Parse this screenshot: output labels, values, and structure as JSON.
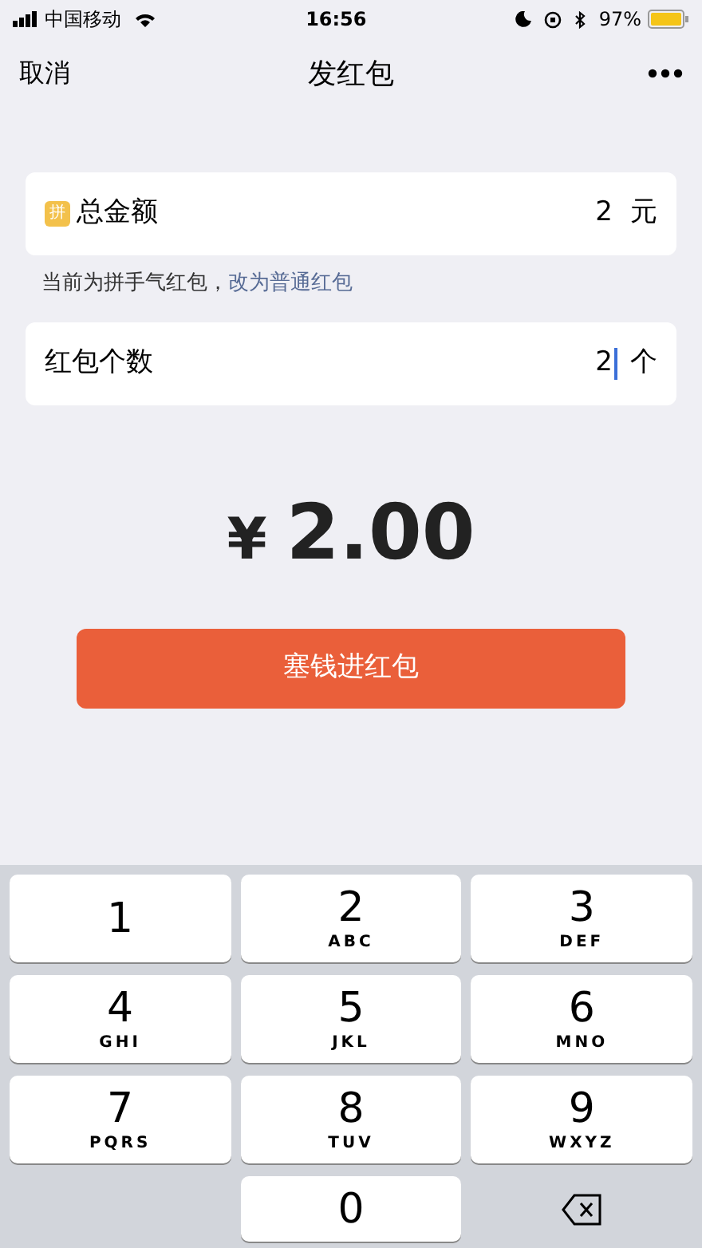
{
  "status_bar": {
    "carrier": "中国移动",
    "time": "16:56",
    "battery": "97%"
  },
  "nav": {
    "cancel": "取消",
    "title": "发红包"
  },
  "amount_field": {
    "badge": "拼",
    "label": "总金额",
    "value": "2",
    "unit": "元",
    "focused": false
  },
  "hint": {
    "text": "当前为拼手气红包，",
    "link": "改为普通红包"
  },
  "count_field": {
    "label": "红包个数",
    "value": "2",
    "unit": "个",
    "focused": true
  },
  "total": {
    "currency": "¥",
    "amount": "2.00"
  },
  "submit_button": "塞钱进红包",
  "keypad": [
    {
      "kind": "digit",
      "digit": "1"
    },
    {
      "kind": "digit",
      "digit": "2",
      "letters": "ABC"
    },
    {
      "kind": "digit",
      "digit": "3",
      "letters": "DEF"
    },
    {
      "kind": "digit",
      "digit": "4",
      "letters": "GHI"
    },
    {
      "kind": "digit",
      "digit": "5",
      "letters": "JKL"
    },
    {
      "kind": "digit",
      "digit": "6",
      "letters": "MNO"
    },
    {
      "kind": "digit",
      "digit": "7",
      "letters": "PQRS"
    },
    {
      "kind": "digit",
      "digit": "8",
      "letters": "TUV"
    },
    {
      "kind": "digit",
      "digit": "9",
      "letters": "WXYZ"
    },
    {
      "kind": "blank"
    },
    {
      "kind": "digit",
      "digit": "0"
    },
    {
      "kind": "delete"
    }
  ]
}
